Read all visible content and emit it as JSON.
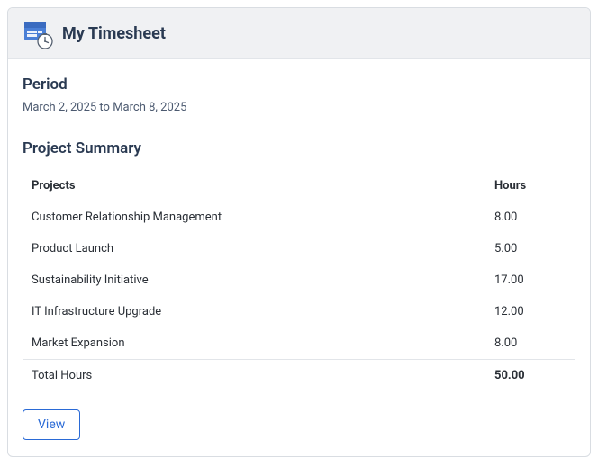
{
  "header": {
    "title": "My Timesheet"
  },
  "period": {
    "label": "Period",
    "value": "March 2, 2025 to March 8, 2025"
  },
  "summary": {
    "title": "Project Summary",
    "columns": {
      "projects": "Projects",
      "hours": "Hours"
    },
    "rows": [
      {
        "project": "Customer Relationship Management",
        "hours": "8.00"
      },
      {
        "project": "Product Launch",
        "hours": "5.00"
      },
      {
        "project": "Sustainability Initiative",
        "hours": "17.00"
      },
      {
        "project": "IT Infrastructure Upgrade",
        "hours": "12.00"
      },
      {
        "project": "Market Expansion",
        "hours": "8.00"
      }
    ],
    "total": {
      "label": "Total Hours",
      "value": "50.00"
    }
  },
  "actions": {
    "view": "View"
  }
}
